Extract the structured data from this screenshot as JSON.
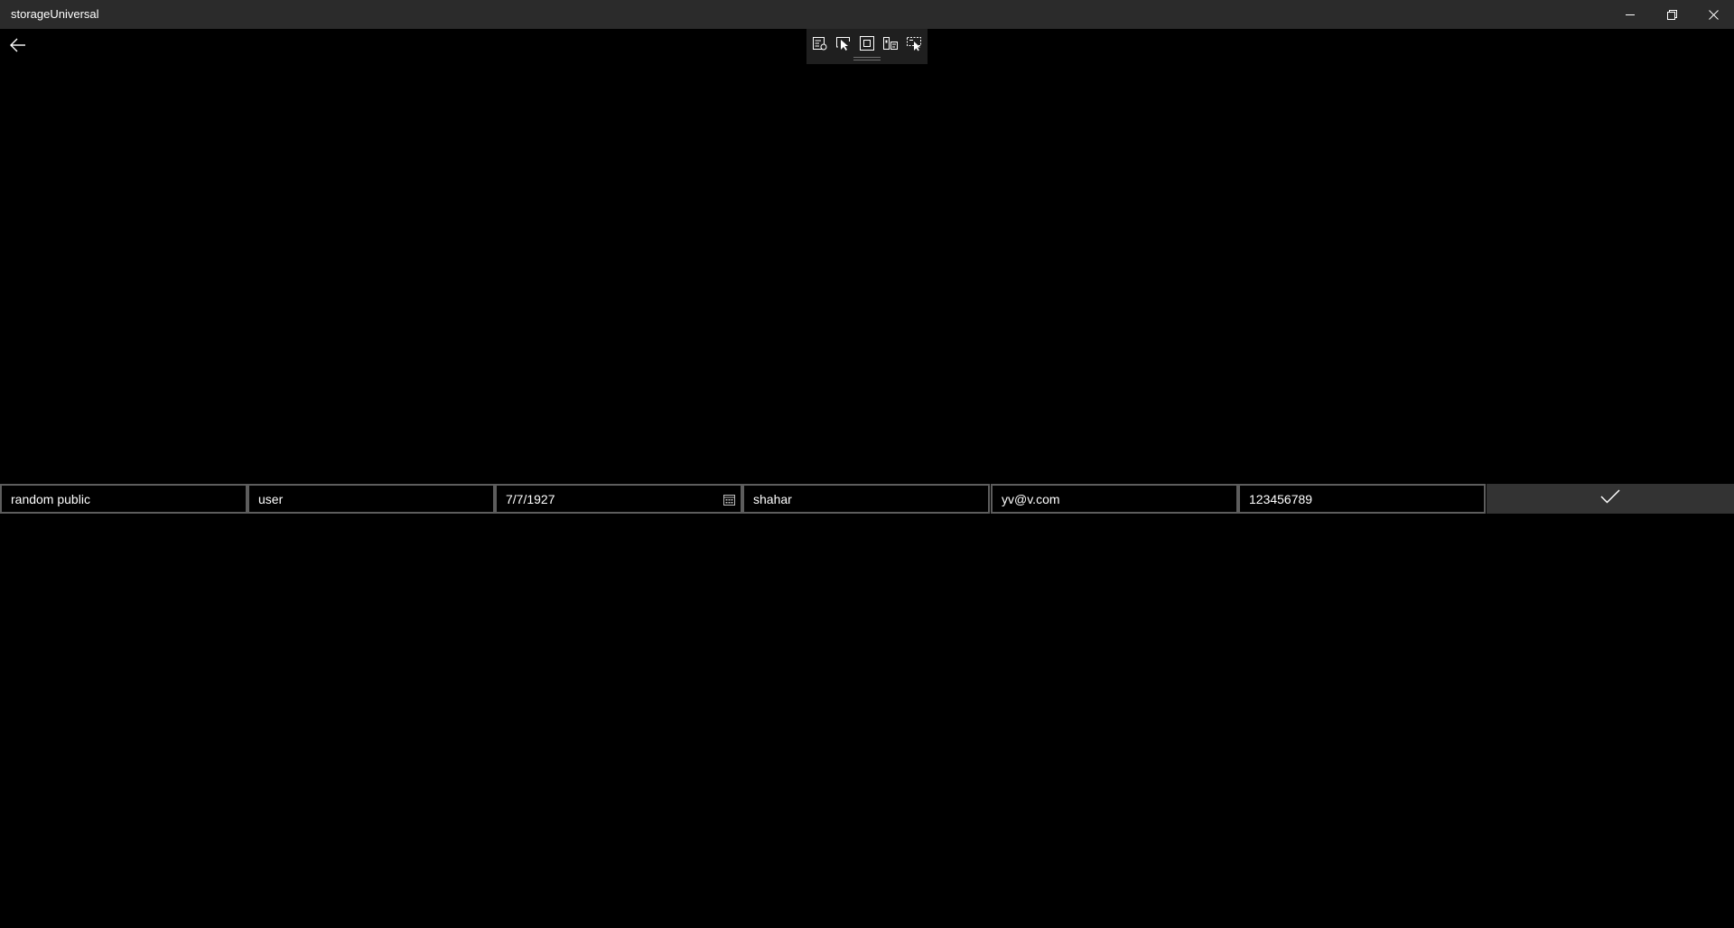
{
  "window": {
    "title": "storageUniversal",
    "controls": {
      "minimize_icon": "minimize-icon",
      "restore_icon": "restore-icon",
      "close_icon": "close-icon"
    }
  },
  "navigation": {
    "back_icon": "back-arrow-icon"
  },
  "debug_toolbar": {
    "tools": [
      "live-visual-tree-icon",
      "select-element-icon",
      "display-layout-adorners-icon",
      "track-focused-element-icon",
      "preview-selection-icon"
    ]
  },
  "form": {
    "fields": [
      {
        "value": "random public"
      },
      {
        "value": "user"
      },
      {
        "value": "7/7/1927",
        "icon": "calendar-icon"
      },
      {
        "value": "shahar"
      },
      {
        "value": "yv@v.com"
      },
      {
        "value": "123456789"
      }
    ],
    "submit_icon": "checkmark-icon"
  },
  "colors": {
    "background": "#000000",
    "titlebar": "#2b2b2b",
    "field_border": "#5d5d5d",
    "submit_background": "#333333",
    "text": "#ffffff"
  }
}
